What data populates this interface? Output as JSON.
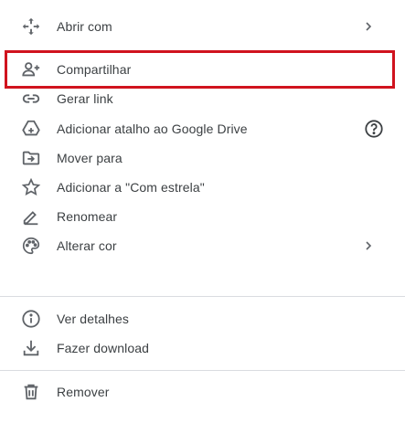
{
  "menu": {
    "items": [
      {
        "label": "Abrir com",
        "icon": "move-arrows-icon"
      },
      {
        "label": "Compartilhar",
        "icon": "person-add-icon"
      },
      {
        "label": "Gerar link",
        "icon": "link-icon"
      },
      {
        "label": "Adicionar atalho ao Google Drive",
        "icon": "drive-shortcut-icon"
      },
      {
        "label": "Mover para",
        "icon": "folder-move-icon"
      },
      {
        "label": "Adicionar a \"Com estrela\"",
        "icon": "star-icon"
      },
      {
        "label": "Renomear",
        "icon": "pencil-icon"
      },
      {
        "label": "Alterar cor",
        "icon": "palette-icon"
      },
      {
        "label": "Ver detalhes",
        "icon": "info-icon"
      },
      {
        "label": "Fazer download",
        "icon": "download-icon"
      },
      {
        "label": "Remover",
        "icon": "trash-icon"
      }
    ],
    "help_icon": "help-circle-icon",
    "submenu_icon": "chevron-right-icon"
  },
  "colors": {
    "icon": "#5f6368",
    "text": "#3c4043",
    "divider": "#dadce0",
    "highlight_border": "#d0131e"
  }
}
